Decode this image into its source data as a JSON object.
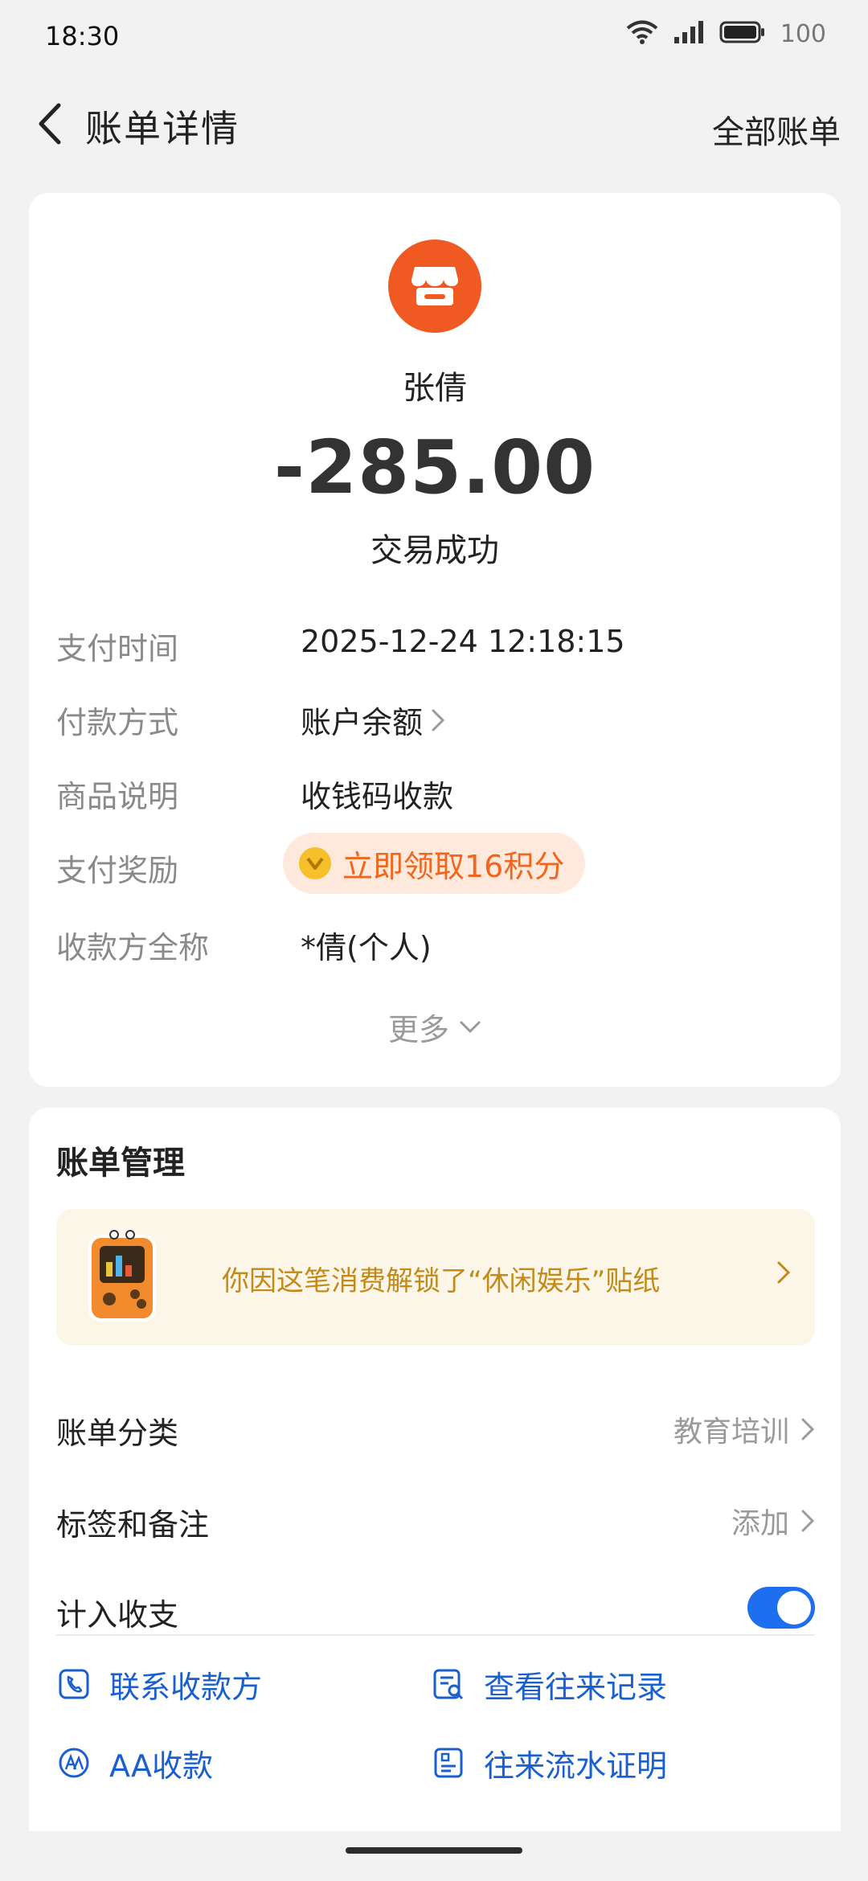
{
  "status_bar": {
    "time": "18:30",
    "battery": "100"
  },
  "header": {
    "title": "账单详情",
    "right_link": "全部账单"
  },
  "transaction": {
    "merchant_icon": "storefront-icon",
    "merchant_name": "张倩",
    "amount": "-285.00",
    "status": "交易成功"
  },
  "details": {
    "pay_time_label": "支付时间",
    "pay_time_value": "2025-12-24 12:18:15",
    "method_label": "付款方式",
    "method_value": "账户余额",
    "desc_label": "商品说明",
    "desc_value": "收钱码收款",
    "reward_label": "支付奖励",
    "reward_value": "立即领取16积分",
    "payee_label": "收款方全称",
    "payee_value": "*倩(个人)",
    "more": "更多"
  },
  "management": {
    "title": "账单管理",
    "sticker_text": "你因这笔消费解锁了“休闲娱乐”贴纸",
    "category_label": "账单分类",
    "category_value": "教育培训",
    "tags_label": "标签和备注",
    "tags_value": "添加",
    "include_label": "计入收支",
    "include_on": true
  },
  "actions": {
    "contact": "联系收款方",
    "history": "查看往来记录",
    "aa": "AA收款",
    "proof": "往来流水证明"
  },
  "colors": {
    "accent": "#1e6ef0",
    "merchant": "#f05a22",
    "reward": "#f0661c",
    "sticker_text": "#c48a18",
    "link": "#1a5fcf"
  }
}
